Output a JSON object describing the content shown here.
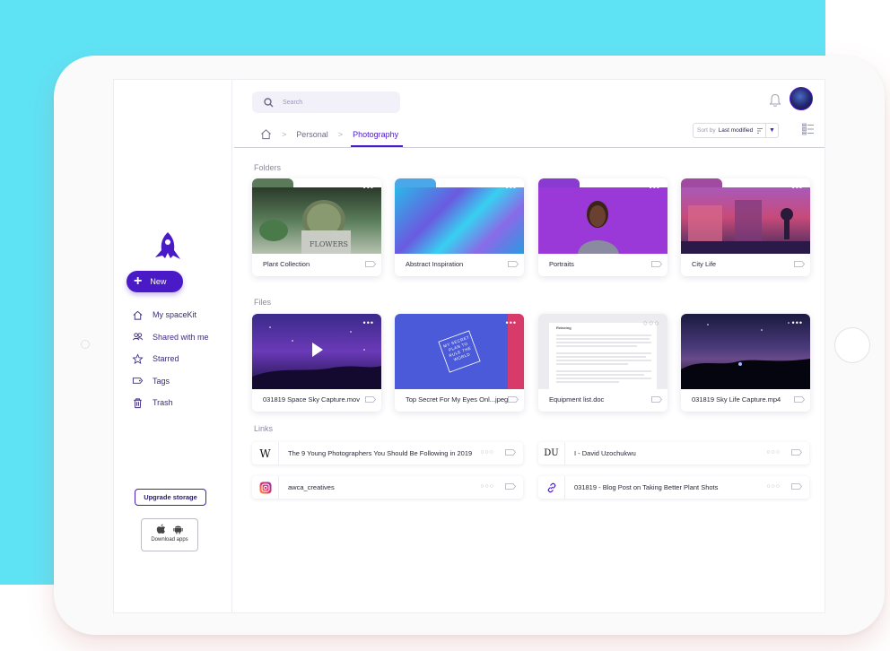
{
  "search": {
    "placeholder": "Search",
    "icon": "search-icon"
  },
  "sidebar": {
    "new_label": "New",
    "items": [
      {
        "label": "My spaceKit",
        "icon": "home-icon"
      },
      {
        "label": "Shared with me",
        "icon": "people-icon"
      },
      {
        "label": "Starred",
        "icon": "star-icon"
      },
      {
        "label": "Tags",
        "icon": "tag-icon"
      },
      {
        "label": "Trash",
        "icon": "trash-icon"
      }
    ],
    "upgrade_label": "Upgrade storage",
    "download_label": "Download apps"
  },
  "breadcrumb": {
    "items": [
      "Personal",
      "Photography"
    ]
  },
  "sort": {
    "prefix": "Sort by",
    "value": "Last modified"
  },
  "sections": {
    "folders": "Folders",
    "files": "Files",
    "links": "Links"
  },
  "folders": [
    {
      "name": "Plant Collection"
    },
    {
      "name": "Abstract Inspiration"
    },
    {
      "name": "Portraits"
    },
    {
      "name": "City Life"
    }
  ],
  "files": [
    {
      "name": "031819 Space Sky Capture.mov"
    },
    {
      "name": "Top Secret For My Eyes Onl...jpeg"
    },
    {
      "name": "Equipment list.doc"
    },
    {
      "name": "031819 Sky Life Capture.mp4"
    }
  ],
  "links": [
    {
      "icon_text": "W",
      "title": "The 9 Young Photographers You Should Be Following in 2019"
    },
    {
      "icon_text": "DU",
      "title": "I - David Uzochukwu"
    },
    {
      "icon_text": "",
      "title": "awca_creatives"
    },
    {
      "icon_text": "",
      "title": "031819 - Blog Post on Taking Better Plant Shots"
    }
  ],
  "book_text": "MY SECRET PLAN TO RULE THE WORLD",
  "doc_title": "Relaxing",
  "colors": {
    "accent": "#4a1ac7",
    "background": "#5ee3f5"
  }
}
